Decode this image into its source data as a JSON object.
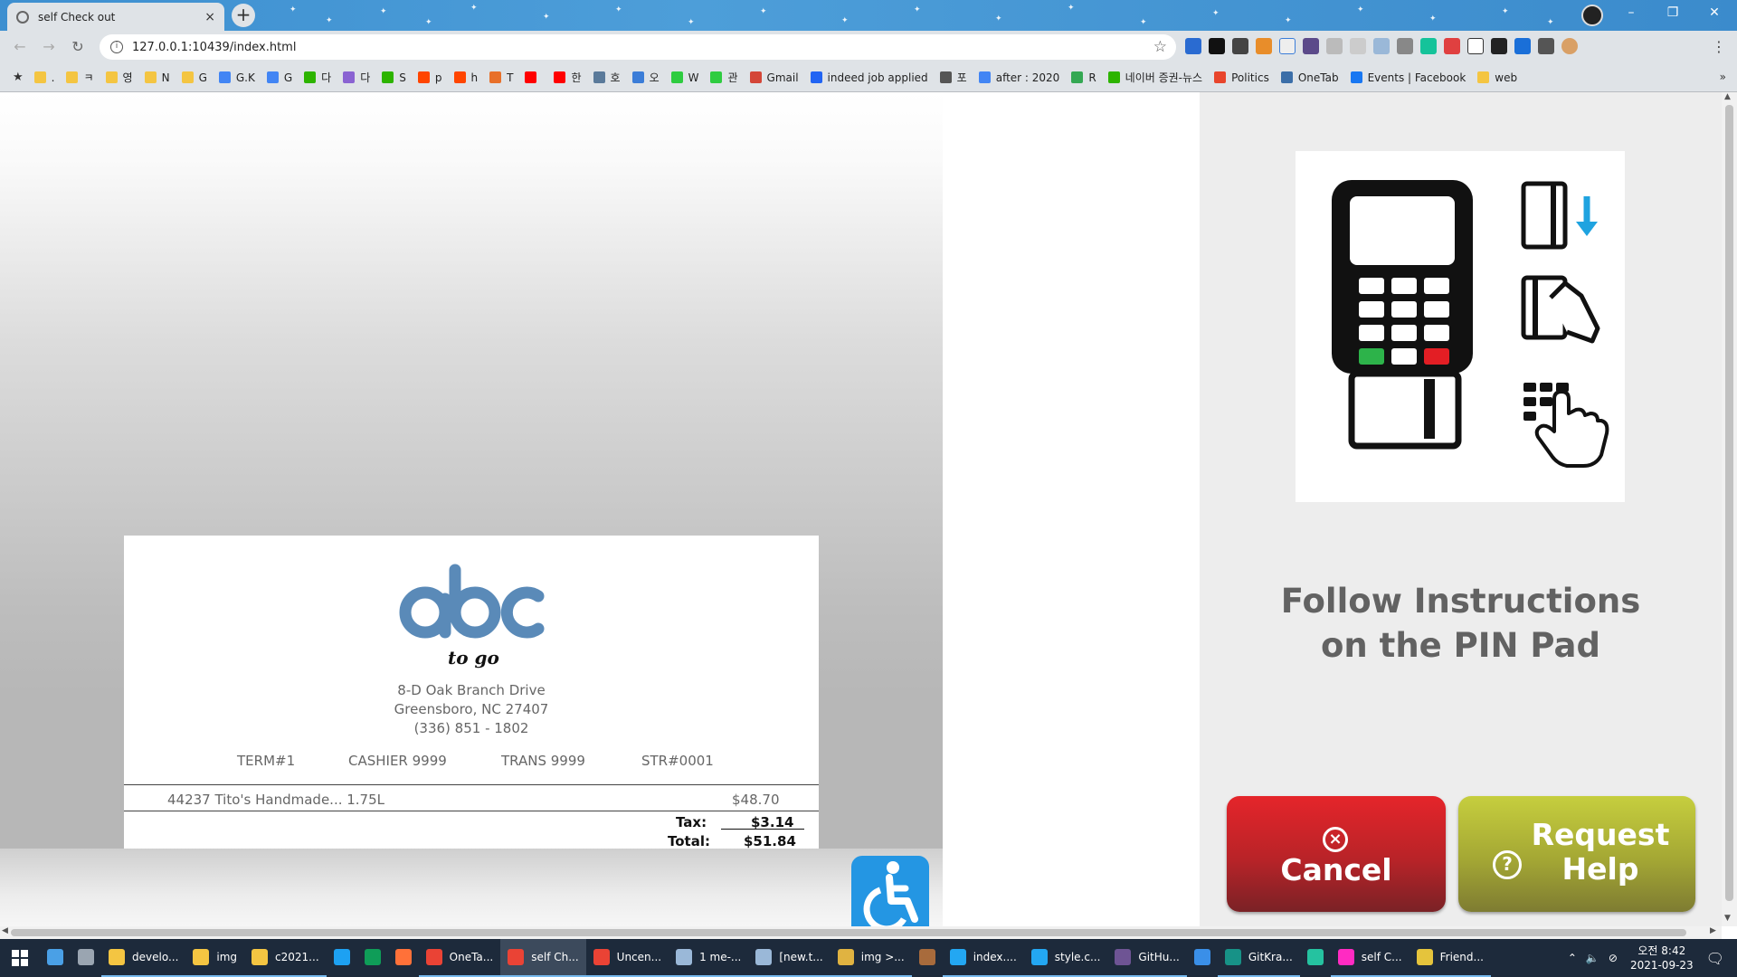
{
  "browser": {
    "tab_title": "self Check out",
    "tab_close": "×",
    "new_tab": "+",
    "url": "127.0.0.1:10439/index.html",
    "window_controls": [
      "–",
      "❐",
      "✕"
    ],
    "bookmarks": [
      {
        "label": ".",
        "color": "#f4c542"
      },
      {
        "label": "ㅋ",
        "color": "#f4c542"
      },
      {
        "label": "영",
        "color": "#f4c542"
      },
      {
        "label": "N",
        "color": "#f4c542"
      },
      {
        "label": "G",
        "color": "#f4c542"
      },
      {
        "label": "G.K",
        "color": "#4285f4"
      },
      {
        "label": "G",
        "color": "#4285f4"
      },
      {
        "label": "다",
        "color": "#2db400"
      },
      {
        "label": "다",
        "color": "#8a63d2"
      },
      {
        "label": "S",
        "color": "#2db400"
      },
      {
        "label": "p",
        "color": "#ff4500"
      },
      {
        "label": "h",
        "color": "#ff4500"
      },
      {
        "label": "T",
        "color": "#e8702a"
      },
      {
        "label": "",
        "color": "#ff0000"
      },
      {
        "label": "한",
        "color": "#ff0000"
      },
      {
        "label": "호",
        "color": "#5a7a9a"
      },
      {
        "label": "오",
        "color": "#3b7dd8"
      },
      {
        "label": "W",
        "color": "#2ecc40"
      },
      {
        "label": "관",
        "color": "#2ecc40"
      },
      {
        "label": "Gmail",
        "color": "#d44638"
      },
      {
        "label": "indeed job applied",
        "color": "#2164f3"
      },
      {
        "label": "포",
        "color": "#555555"
      },
      {
        "label": "after : 2020",
        "color": "#4285f4"
      },
      {
        "label": "R",
        "color": "#34a853"
      },
      {
        "label": "네이버 증권-뉴스",
        "color": "#2db400"
      },
      {
        "label": "Politics",
        "color": "#e8452c"
      },
      {
        "label": "OneTab",
        "color": "#3b6ea8"
      },
      {
        "label": "Events | Facebook",
        "color": "#1877f2"
      },
      {
        "label": "web",
        "color": "#f4c542"
      }
    ],
    "bookmarks_more": "»"
  },
  "receipt": {
    "logo_word": "abc",
    "logo_tagline": "to go",
    "address_line1": "8-D Oak Branch Drive",
    "address_line2": "Greensboro, NC 27407",
    "phone": "(336) 851 - 1802",
    "term": "TERM#1",
    "cashier": "CASHIER 9999",
    "trans": "TRANS 9999",
    "store": "STR#0001",
    "items": [
      {
        "name": "44237 Tito's Handmade... 1.75L",
        "price": "$48.70"
      }
    ],
    "tax_label": "Tax:",
    "tax_value": "$3.14",
    "total_label": "Total:",
    "total_value": "$51.84"
  },
  "payment": {
    "instruction": "Follow Instructions on the PIN Pad",
    "cancel_label": "Cancel",
    "help_label": "Request Help",
    "accent_cancel": "#c8232a",
    "accent_help": "#b4b838"
  },
  "taskbar": {
    "items": [
      {
        "label": "",
        "color": "#4aa0e6"
      },
      {
        "label": "",
        "color": "#9aa5b1"
      },
      {
        "label": "develo...",
        "color": "#f4c542"
      },
      {
        "label": "img",
        "color": "#f4c542"
      },
      {
        "label": "c2021...",
        "color": "#f4c542"
      },
      {
        "label": "",
        "color": "#1da1f2"
      },
      {
        "label": "",
        "color": "#0f9d58"
      },
      {
        "label": "",
        "color": "#ff7139"
      },
      {
        "label": "OneTa...",
        "color": "#ea4335"
      },
      {
        "label": "self Ch...",
        "color": "#ea4335"
      },
      {
        "label": "Uncen...",
        "color": "#ea4335"
      },
      {
        "label": "1 me-...",
        "color": "#9ab8d8"
      },
      {
        "label": "[new.t...",
        "color": "#9ab8d8"
      },
      {
        "label": "img >...",
        "color": "#e0b341"
      },
      {
        "label": "",
        "color": "#a86b3c"
      },
      {
        "label": "index....",
        "color": "#23a7f2"
      },
      {
        "label": "style.c...",
        "color": "#23a7f2"
      },
      {
        "label": "GitHu...",
        "color": "#6e5494"
      },
      {
        "label": "",
        "color": "#3a8fe8"
      },
      {
        "label": "GitKra...",
        "color": "#179287"
      },
      {
        "label": "",
        "color": "#25c2a0"
      },
      {
        "label": "self C...",
        "color": "#ff2bc2"
      },
      {
        "label": "Friend...",
        "color": "#e5c43c"
      }
    ],
    "clock_time": "오전 8:42",
    "clock_date": "2021-09-23"
  }
}
